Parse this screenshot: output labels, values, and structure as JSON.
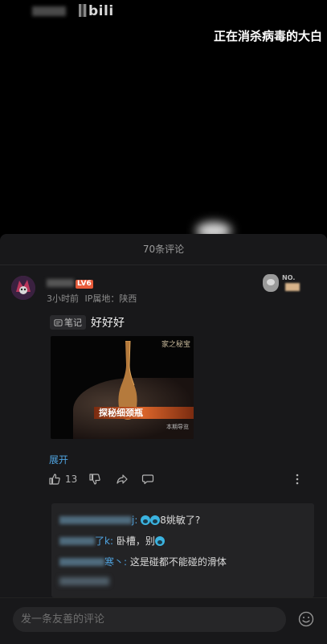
{
  "video": {
    "logo": "bili",
    "title": "正在消杀病毒的大白"
  },
  "comments_panel": {
    "header": "70条评论",
    "comment": {
      "username_visible": "",
      "level": "LV6",
      "time": "3小时前",
      "location": "IP属地：陕西",
      "fan_badge": "NO.",
      "note_tag": "笔记",
      "text": "好好好",
      "image": {
        "watermark": "家之秘宝",
        "banner": "探秘细颈瓶",
        "subtitle": "本期导览"
      },
      "expand_label": "展开",
      "likes": "13"
    },
    "replies": [
      {
        "name_suffix": "j:",
        "text": "8姚敏了?"
      },
      {
        "name_suffix": "了k:",
        "text": "卧槽，别"
      },
      {
        "name_suffix": "寒丶:",
        "text": "这是碰都不能碰的滑体"
      }
    ],
    "input_placeholder": "发一条友善的评论"
  },
  "colors": {
    "accent_blue": "#4fa3e0",
    "level_badge": "#e85b3a",
    "panel_bg": "#18181a"
  }
}
